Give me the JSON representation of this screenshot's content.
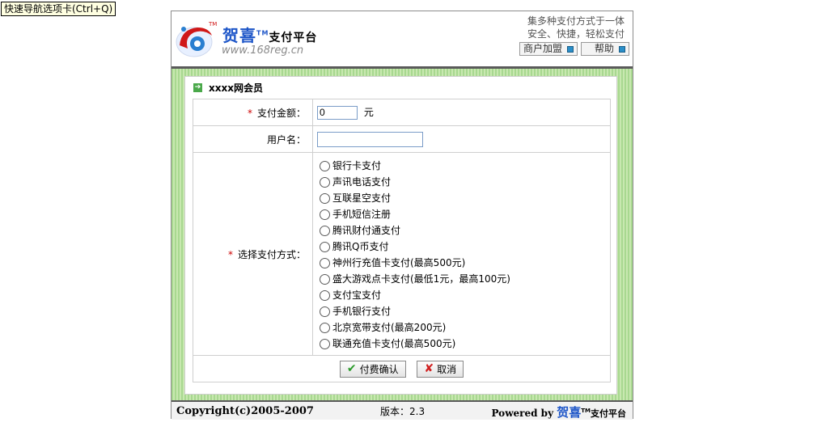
{
  "tooltip": "快速导航选项卡(Ctrl+Q)",
  "header": {
    "brand_main": "贺喜",
    "brand_sub": "支付平台",
    "tm": "TM",
    "site": "www.168reg.cn",
    "slogan_line1": "集多种支付方式于一体",
    "slogan_line2": "安全、快捷，轻松支付",
    "merchant_button": "商户加盟",
    "help_button": "帮助"
  },
  "panel": {
    "title": "xxxx网会员",
    "amount_label": "支付金额：",
    "amount_value": "0",
    "amount_unit": "元",
    "username_label": "用户名：",
    "username_value": "",
    "method_label": "选择支付方式：",
    "methods": [
      "银行卡支付",
      "声讯电话支付",
      "互联星空支付",
      "手机短信注册",
      "腾讯财付通支付",
      "腾讯Q币支付",
      "神州行充值卡支付(最高500元)",
      "盛大游戏点卡支付(最低1元，最高100元)",
      "支付宝支付",
      "手机银行支付",
      "北京宽带支付(最高200元)",
      "联通充值卡支付(最高500元)"
    ],
    "confirm_button": "付费确认",
    "cancel_button": "取消"
  },
  "footer": {
    "copyright": "Copyright(c)2005-2007",
    "version_label": "版本：",
    "version_value": "2.3",
    "powered_by": "Powered by",
    "powered_brand": "贺喜",
    "powered_rest": "支付平台",
    "tm": "TM"
  },
  "colors": {
    "brand_blue": "#1e56c8",
    "required_red": "#cc0000",
    "green_stripe": "#a8d890"
  }
}
